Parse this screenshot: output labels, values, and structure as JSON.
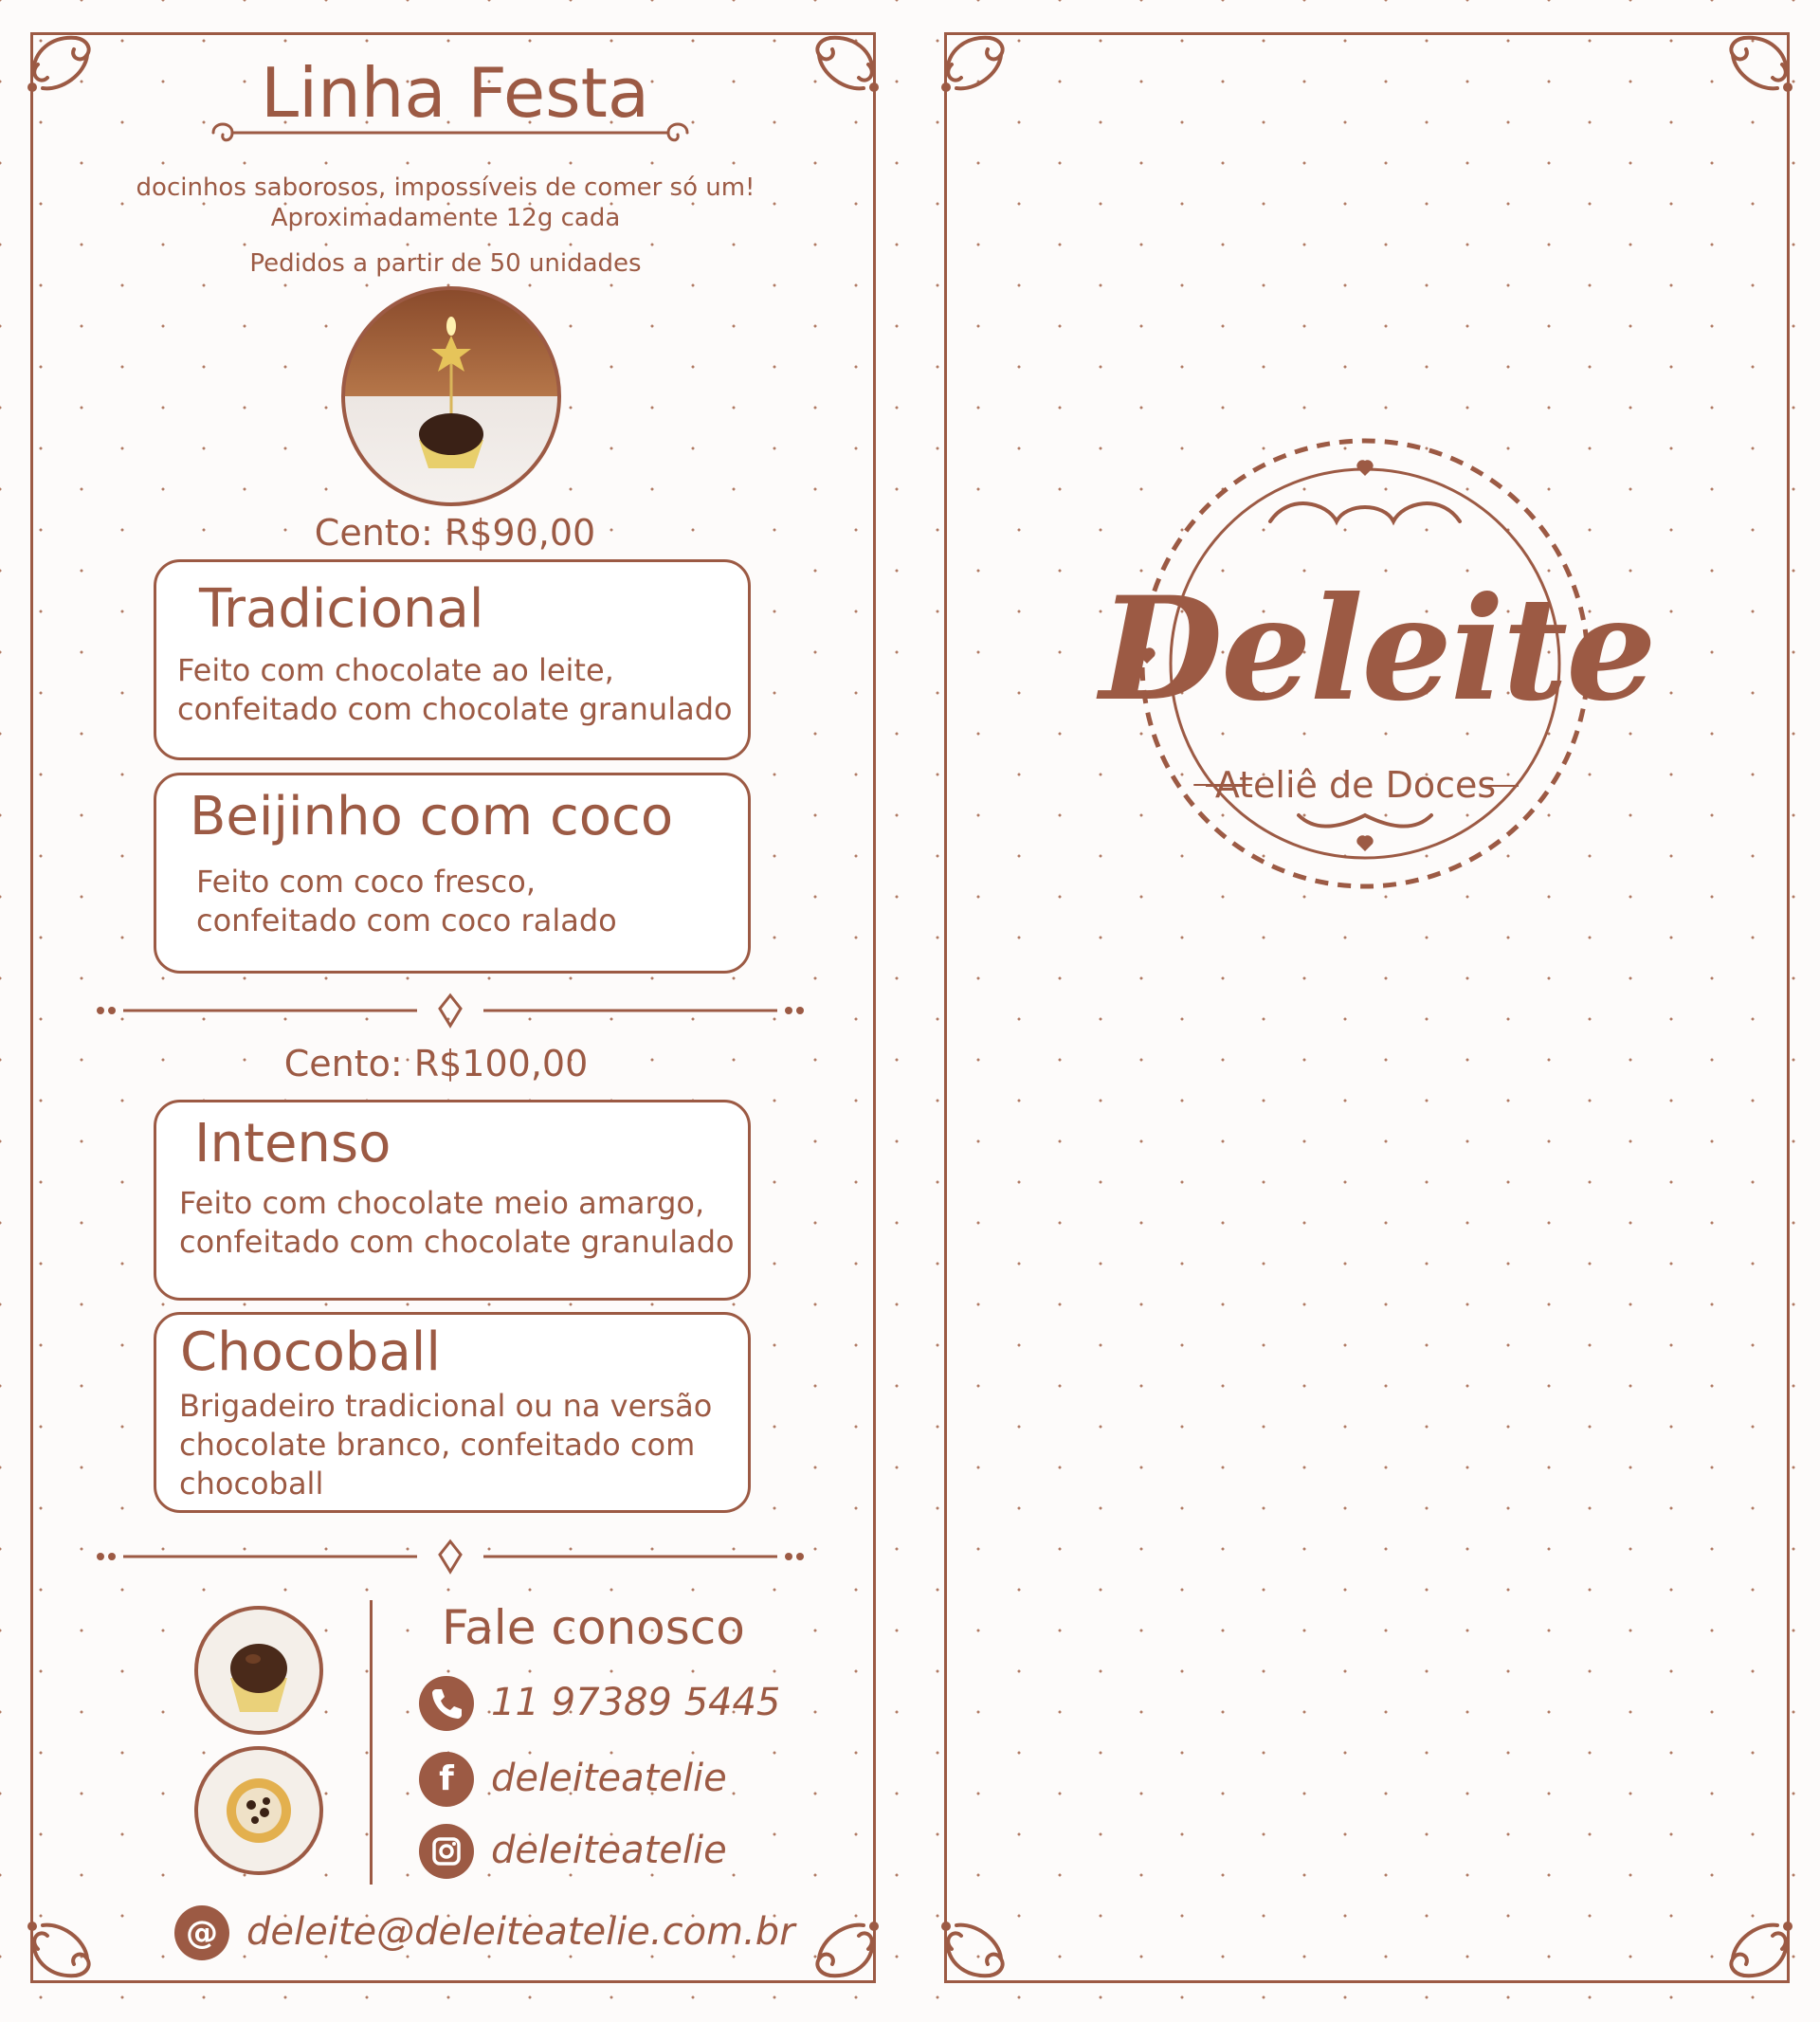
{
  "menu": {
    "title": "Linha Festa",
    "tagline": "docinhos saborosos, impossíveis de comer só um!",
    "weight_note": "Aproximadamente 12g cada",
    "min_order": "Pedidos a partir de 50 unidades",
    "section_1": {
      "price": "Cento: R$90,00",
      "items": [
        {
          "name": "Tradicional",
          "line1": "Feito com chocolate ao leite,",
          "line2": "confeitado com chocolate granulado"
        },
        {
          "name": "Beijinho com coco",
          "line1": "Feito com coco fresco,",
          "line2": "confeitado com coco ralado"
        }
      ]
    },
    "section_2": {
      "price": "Cento: R$100,00",
      "items": [
        {
          "name": "Intenso",
          "line1": "Feito com chocolate meio amargo,",
          "line2": "confeitado com chocolate granulado"
        },
        {
          "name": "Chocoball",
          "line1": "Brigadeiro tradicional ou na versão",
          "line2": "chocolate branco, confeitado com",
          "line3": "chocoball"
        }
      ]
    }
  },
  "contact": {
    "heading": "Fale conosco",
    "phone": "11 97389 5445",
    "facebook": "deleiteatelie",
    "instagram": "deleiteatelie",
    "email": "deleite@deleiteatelie.com.br",
    "icons": {
      "phone": "phone-icon",
      "facebook": "facebook-icon",
      "instagram": "instagram-icon",
      "email": "at-sign-icon"
    }
  },
  "cover": {
    "brand": "Deleite",
    "subtitle": "Ateliê de Doces"
  },
  "colors": {
    "accent": "#9c5a44",
    "background": "#fdfbfa",
    "gold": "#e6c45a"
  }
}
